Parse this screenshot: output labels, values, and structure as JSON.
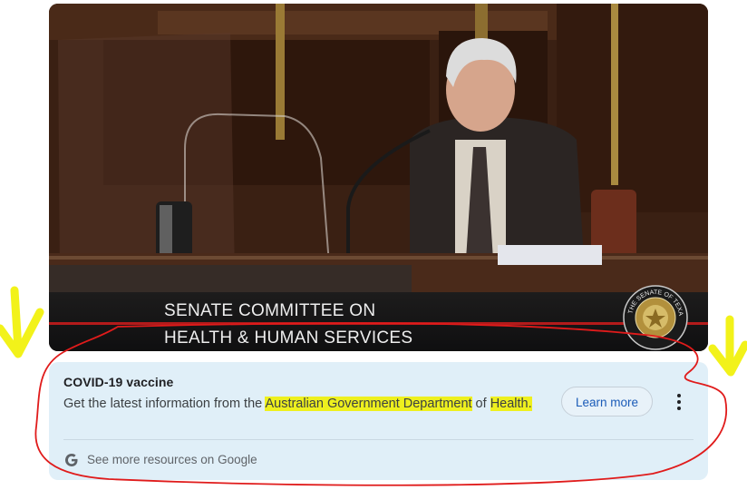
{
  "video": {
    "caption_line1": "SENATE COMMITTEE ON",
    "caption_line2": "HEALTH & HUMAN SERVICES",
    "seal_text": "THE SENATE OF TEXAS"
  },
  "info_panel": {
    "title": "COVID-19 vaccine",
    "text_before": "Get the latest information from the ",
    "highlight1": "Australian Government Department",
    "text_middle": " of ",
    "highlight2": "Health.",
    "button_label": "Learn more",
    "more_icon": "more-vert-icon",
    "footer_icon": "google-g-icon",
    "footer_link": "See more resources on Google"
  },
  "annotations": {
    "highlight_color": "#eef01e",
    "circle_color": "#e01b1b",
    "arrow_color": "#f2f21a"
  }
}
